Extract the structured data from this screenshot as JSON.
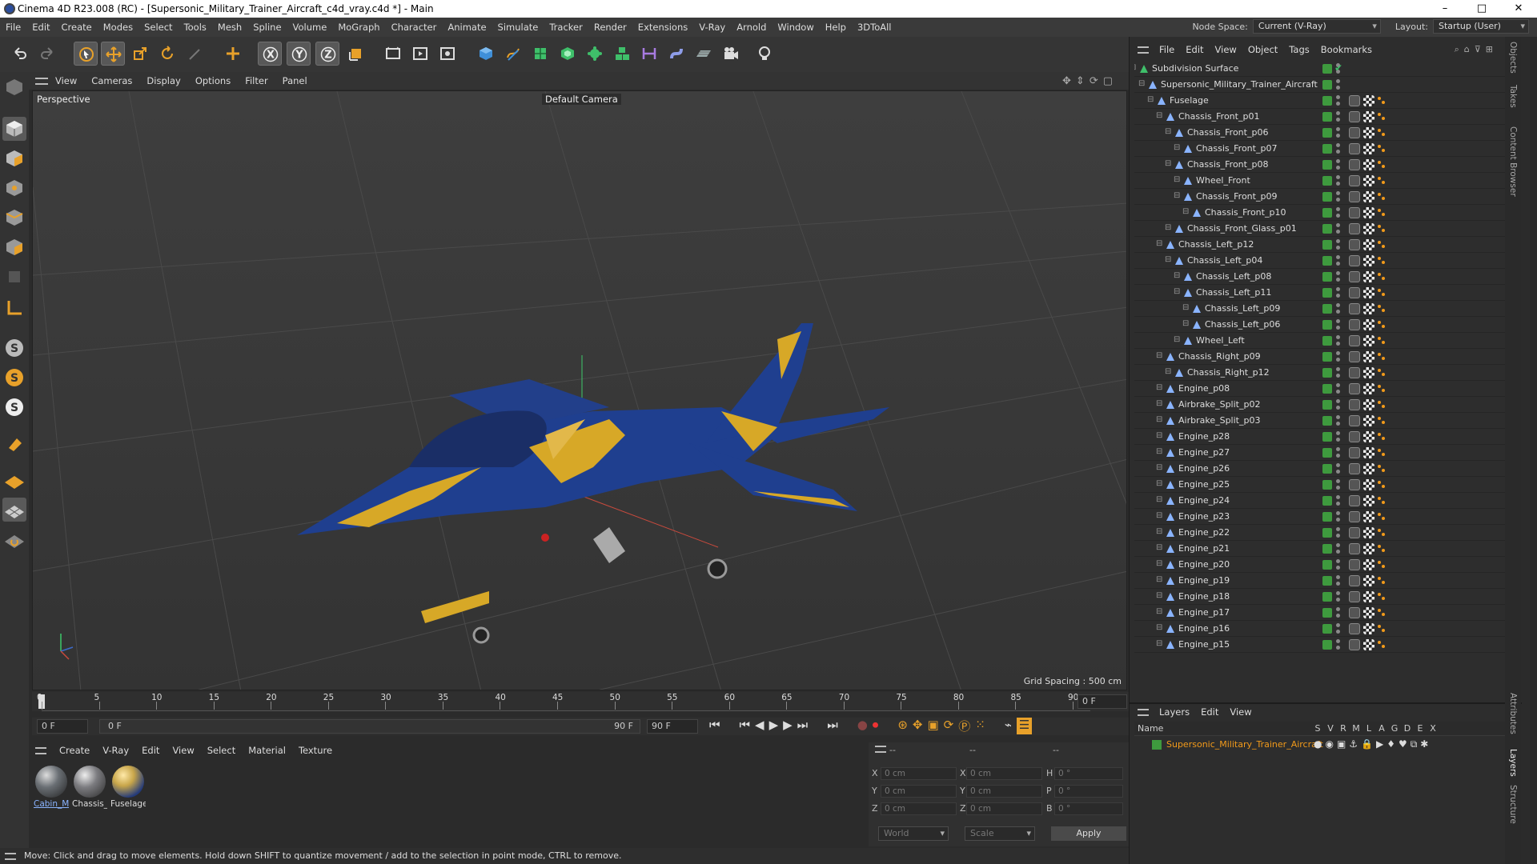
{
  "window": {
    "title": "Cinema 4D R23.008 (RC) - [Supersonic_Military_Trainer_Aircraft_c4d_vray.c4d *] - Main",
    "controls": [
      "–",
      "□",
      "✕"
    ]
  },
  "menubar": {
    "items": [
      "File",
      "Edit",
      "Create",
      "Modes",
      "Select",
      "Tools",
      "Mesh",
      "Spline",
      "Volume",
      "MoGraph",
      "Character",
      "Animate",
      "Simulate",
      "Tracker",
      "Render",
      "Extensions",
      "V-Ray",
      "Arnold",
      "Window",
      "Help",
      "3DToAll"
    ],
    "node_space_label": "Node Space:",
    "node_space_value": "Current (V-Ray)",
    "layout_label": "Layout:",
    "layout_value": "Startup (User)"
  },
  "toolbar": {
    "icons": [
      "undo-icon",
      "redo-icon",
      "select-icon",
      "move-icon",
      "scale-icon",
      "rotate-icon",
      "recent-tool-icon",
      "add-icon",
      "x-axis-icon",
      "y-axis-icon",
      "z-axis-icon",
      "world-coords-icon",
      "render-region-icon",
      "render-view-icon",
      "render-settings-icon",
      "cube-icon",
      "pen-icon",
      "subdivision-icon",
      "extrude-icon",
      "cloner-icon",
      "array-icon",
      "measure-icon",
      "deformer-icon",
      "floor-icon",
      "camera-icon",
      "light-icon"
    ]
  },
  "left_tools": {
    "icons": [
      "make-editable-icon",
      "model-mode-icon",
      "texture-mode-icon",
      "points-mode-icon",
      "edges-mode-icon",
      "polygons-mode-icon",
      "uv-mode-icon",
      "axis-icon",
      "snap-icon",
      "solo-icon",
      "solo-hierarchy-icon",
      "magnet-icon",
      "layer-grid-icon",
      "workplane-icon",
      "sculpt-icon"
    ]
  },
  "viewport": {
    "menu": [
      "View",
      "Cameras",
      "Display",
      "Options",
      "Filter",
      "Panel"
    ],
    "label": "Perspective",
    "camera": "Default Camera",
    "grid_spacing": "Grid Spacing : 500 cm"
  },
  "timeline": {
    "ticks": [
      "0",
      "5",
      "10",
      "15",
      "20",
      "25",
      "30",
      "35",
      "40",
      "45",
      "50",
      "55",
      "60",
      "65",
      "70",
      "75",
      "80",
      "85",
      "90"
    ],
    "current_frame": "0 F",
    "start_frame": "0 F",
    "range_start": "0 F",
    "range_end": "90 F",
    "end_frame": "90 F"
  },
  "material_bar": {
    "menu": [
      "Create",
      "V-Ray",
      "Edit",
      "View",
      "Select",
      "Material",
      "Texture"
    ],
    "materials": [
      {
        "label": "Cabin_M",
        "color": "#6a6f74"
      },
      {
        "label": "Chassis_",
        "color": "#7c7c80"
      },
      {
        "label": "Fuselage",
        "color": "#c8a64a"
      }
    ]
  },
  "coordinates": {
    "headers": [
      "--",
      "--",
      "--"
    ],
    "rows": [
      {
        "a_label": "X",
        "a_val": "0 cm",
        "b_label": "X",
        "b_val": "0 cm",
        "c_label": "H",
        "c_val": "0 °"
      },
      {
        "a_label": "Y",
        "a_val": "0 cm",
        "b_label": "Y",
        "b_val": "0 cm",
        "c_label": "P",
        "c_val": "0 °"
      },
      {
        "a_label": "Z",
        "a_val": "0 cm",
        "b_label": "Z",
        "b_val": "0 cm",
        "c_label": "B",
        "c_val": "0 °"
      }
    ],
    "mode1": "World",
    "mode2": "Scale",
    "apply": "Apply"
  },
  "status": "Move: Click and drag to move elements. Hold down SHIFT to quantize movement / add to the selection in point mode, CTRL to remove.",
  "objects_panel": {
    "menu": [
      "File",
      "Edit",
      "View",
      "Object",
      "Tags",
      "Bookmarks"
    ],
    "items": [
      {
        "name": "Subdivision Surface",
        "depth": 0,
        "type": "subdiv"
      },
      {
        "name": "Supersonic_Military_Trainer_Aircraft",
        "depth": 1,
        "type": "null"
      },
      {
        "name": "Fuselage",
        "depth": 2,
        "type": "poly"
      },
      {
        "name": "Chassis_Front_p01",
        "depth": 3,
        "type": "poly"
      },
      {
        "name": "Chassis_Front_p06",
        "depth": 4,
        "type": "poly"
      },
      {
        "name": "Chassis_Front_p07",
        "depth": 5,
        "type": "poly"
      },
      {
        "name": "Chassis_Front_p08",
        "depth": 4,
        "type": "poly"
      },
      {
        "name": "Wheel_Front",
        "depth": 5,
        "type": "poly"
      },
      {
        "name": "Chassis_Front_p09",
        "depth": 5,
        "type": "poly"
      },
      {
        "name": "Chassis_Front_p10",
        "depth": 6,
        "type": "poly"
      },
      {
        "name": "Chassis_Front_Glass_p01",
        "depth": 4,
        "type": "poly"
      },
      {
        "name": "Chassis_Left_p12",
        "depth": 3,
        "type": "poly"
      },
      {
        "name": "Chassis_Left_p04",
        "depth": 4,
        "type": "poly"
      },
      {
        "name": "Chassis_Left_p08",
        "depth": 5,
        "type": "poly"
      },
      {
        "name": "Chassis_Left_p11",
        "depth": 5,
        "type": "poly"
      },
      {
        "name": "Chassis_Left_p09",
        "depth": 6,
        "type": "poly"
      },
      {
        "name": "Chassis_Left_p06",
        "depth": 6,
        "type": "poly"
      },
      {
        "name": "Wheel_Left",
        "depth": 5,
        "type": "poly"
      },
      {
        "name": "Chassis_Right_p09",
        "depth": 3,
        "type": "poly"
      },
      {
        "name": "Chassis_Right_p12",
        "depth": 4,
        "type": "poly"
      },
      {
        "name": "Engine_p08",
        "depth": 3,
        "type": "poly"
      },
      {
        "name": "Airbrake_Split_p02",
        "depth": 3,
        "type": "poly"
      },
      {
        "name": "Airbrake_Split_p03",
        "depth": 3,
        "type": "poly"
      },
      {
        "name": "Engine_p28",
        "depth": 3,
        "type": "poly"
      },
      {
        "name": "Engine_p27",
        "depth": 3,
        "type": "poly"
      },
      {
        "name": "Engine_p26",
        "depth": 3,
        "type": "poly"
      },
      {
        "name": "Engine_p25",
        "depth": 3,
        "type": "poly"
      },
      {
        "name": "Engine_p24",
        "depth": 3,
        "type": "poly"
      },
      {
        "name": "Engine_p23",
        "depth": 3,
        "type": "poly"
      },
      {
        "name": "Engine_p22",
        "depth": 3,
        "type": "poly"
      },
      {
        "name": "Engine_p21",
        "depth": 3,
        "type": "poly"
      },
      {
        "name": "Engine_p20",
        "depth": 3,
        "type": "poly"
      },
      {
        "name": "Engine_p19",
        "depth": 3,
        "type": "poly"
      },
      {
        "name": "Engine_p18",
        "depth": 3,
        "type": "poly"
      },
      {
        "name": "Engine_p17",
        "depth": 3,
        "type": "poly"
      },
      {
        "name": "Engine_p16",
        "depth": 3,
        "type": "poly"
      },
      {
        "name": "Engine_p15",
        "depth": 3,
        "type": "poly"
      }
    ]
  },
  "layers_panel": {
    "menu": [
      "Layers",
      "Edit",
      "View"
    ],
    "name_col": "Name",
    "flag_cols": [
      "S",
      "V",
      "R",
      "M",
      "L",
      "A",
      "G",
      "D",
      "E",
      "X"
    ],
    "layer_name": "Supersonic_Military_Trainer_Aircraft",
    "layer_color": "#3e9a3e"
  },
  "side_tabs": [
    "Objects",
    "Takes",
    "Content Browser",
    "Attributes",
    "Layers",
    "Structure"
  ],
  "colors": {
    "accent": "#f29a1a",
    "visible_green": "#3e9a3e",
    "jet_blue": "#1f3f8f",
    "jet_yellow": "#d7a827"
  }
}
